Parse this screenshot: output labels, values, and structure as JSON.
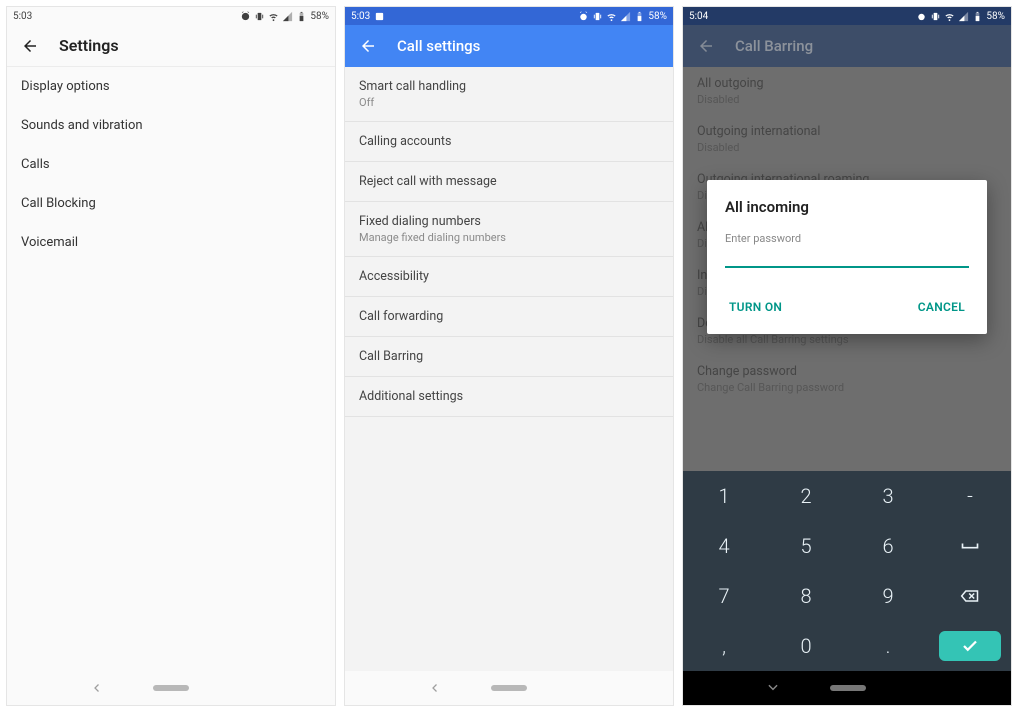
{
  "status": {
    "time_a": "5:03",
    "time_b": "5:03",
    "time_c": "5:04",
    "battery_text": "58%"
  },
  "screen1": {
    "title": "Settings",
    "items": [
      "Display options",
      "Sounds and vibration",
      "Calls",
      "Call Blocking",
      "Voicemail"
    ]
  },
  "screen2": {
    "title": "Call settings",
    "items": [
      {
        "t": "Smart call handling",
        "s": "Off"
      },
      {
        "t": "Calling accounts"
      },
      {
        "t": "Reject call with message"
      },
      {
        "t": "Fixed dialing numbers",
        "s": "Manage fixed dialing numbers"
      },
      {
        "t": "Accessibility"
      },
      {
        "t": "Call forwarding"
      },
      {
        "t": "Call Barring"
      },
      {
        "t": "Additional settings"
      }
    ]
  },
  "screen3": {
    "title": "Call Barring",
    "items": [
      {
        "t": "All outgoing",
        "s": "Disabled"
      },
      {
        "t": "Outgoing international",
        "s": "Disabled"
      },
      {
        "t": "Outgoing international roaming",
        "s": "Disabled"
      },
      {
        "t": "All incoming",
        "s": "Disabled"
      },
      {
        "t": "Incoming when roaming",
        "s": "Disabled"
      },
      {
        "t": "Deactivate Call Barring",
        "s": "Disable all Call Barring settings"
      },
      {
        "t": "Change password",
        "s": "Change Call Barring password"
      }
    ],
    "dialog": {
      "title": "All incoming",
      "label": "Enter password",
      "value": "",
      "confirm": "TURN ON",
      "cancel": "CANCEL"
    },
    "keypad": {
      "rows": [
        [
          "1",
          "2",
          "3",
          "-"
        ],
        [
          "4",
          "5",
          "6",
          "␣"
        ],
        [
          "7",
          "8",
          "9",
          "⌫"
        ],
        [
          ",",
          "0",
          ".",
          "✓"
        ]
      ]
    }
  }
}
